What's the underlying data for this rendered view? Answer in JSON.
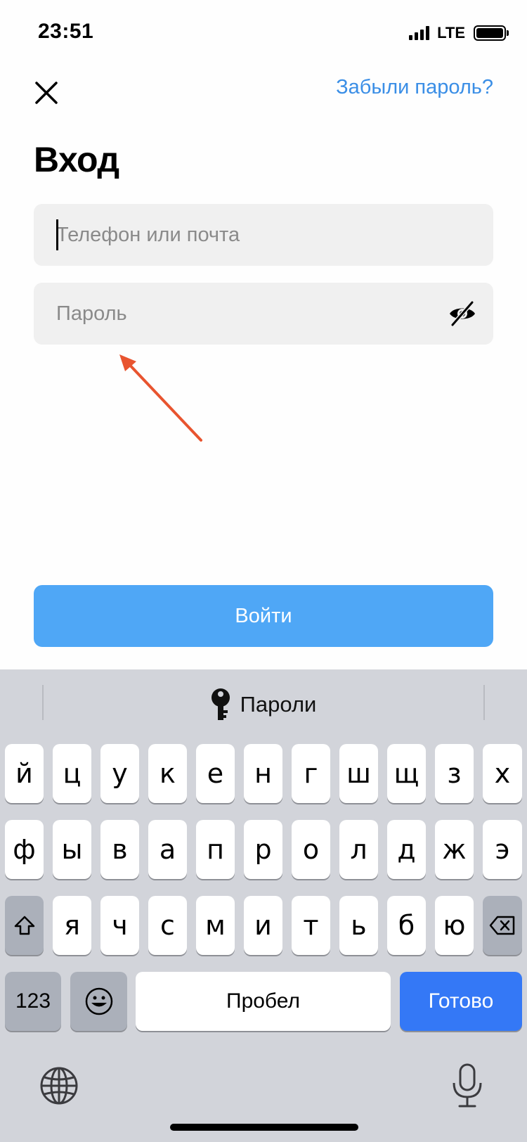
{
  "status_bar": {
    "time": "23:51",
    "network": "LTE"
  },
  "header": {
    "forgot_password": "Забыли пароль?"
  },
  "title": "Вход",
  "fields": {
    "phone": {
      "placeholder": "Телефон или почта",
      "value": ""
    },
    "password": {
      "placeholder": "Пароль",
      "value": ""
    }
  },
  "login_button": "Войти",
  "keyboard": {
    "suggestion": "Пароли",
    "row1": [
      "й",
      "ц",
      "у",
      "к",
      "е",
      "н",
      "г",
      "ш",
      "щ",
      "з",
      "х"
    ],
    "row2": [
      "ф",
      "ы",
      "в",
      "а",
      "п",
      "р",
      "о",
      "л",
      "д",
      "ж",
      "э"
    ],
    "row3": [
      "я",
      "ч",
      "с",
      "м",
      "и",
      "т",
      "ь",
      "б",
      "ю"
    ],
    "numbers_key": "123",
    "space_key": "Пробел",
    "done_key": "Готово"
  },
  "colors": {
    "accent": "#3a8ee6",
    "login_button": "#4fa7f6",
    "done_key": "#3478f6",
    "annotation_arrow": "#e8542f"
  },
  "icons": [
    "close-icon",
    "eye-off-icon",
    "key-icon",
    "shift-icon",
    "backspace-icon",
    "emoji-icon",
    "globe-icon",
    "microphone-icon"
  ]
}
